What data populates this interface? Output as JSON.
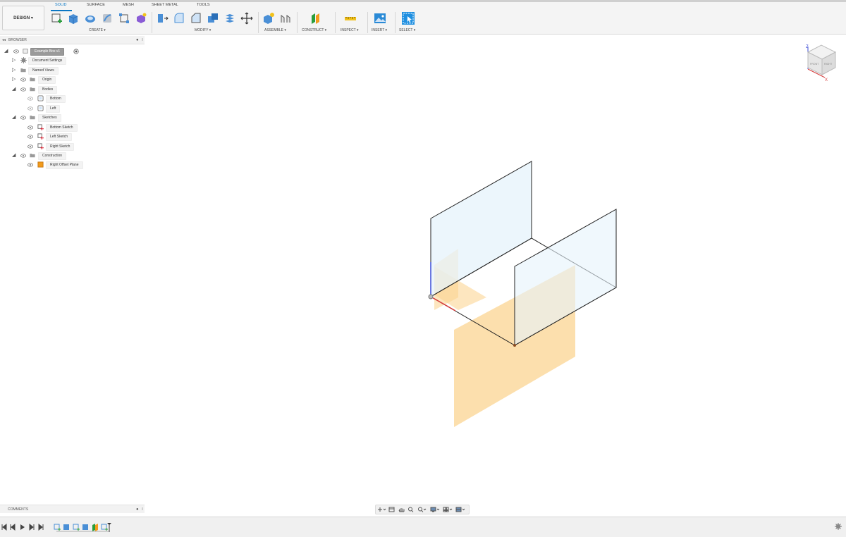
{
  "workspace": {
    "label": "DESIGN ▾"
  },
  "tabs": [
    {
      "label": "SOLID",
      "active": true
    },
    {
      "label": "SURFACE",
      "active": false
    },
    {
      "label": "MESH",
      "active": false
    },
    {
      "label": "SHEET METAL",
      "active": false
    },
    {
      "label": "TOOLS",
      "active": false
    }
  ],
  "groups": {
    "create": "CREATE ▾",
    "modify": "MODIFY ▾",
    "assemble": "ASSEMBLE ▾",
    "construct": "CONSTRUCT ▾",
    "inspect": "INSPECT ▾",
    "insert": "INSERT ▾",
    "select": "SELECT ▾"
  },
  "browser": {
    "title": "BROWSER",
    "items": [
      {
        "label": "Example Box v1",
        "icon": "document-icon",
        "selected": true
      },
      {
        "label": "Document Settings",
        "icon": "gear-icon"
      },
      {
        "label": "Named Views",
        "icon": "folder-icon"
      },
      {
        "label": "Origin",
        "icon": "folder-icon"
      },
      {
        "label": "Bodies",
        "icon": "folder-icon"
      },
      {
        "label": "Bottom",
        "icon": "body-icon"
      },
      {
        "label": "Left",
        "icon": "body-icon"
      },
      {
        "label": "Sketches",
        "icon": "folder-icon"
      },
      {
        "label": "Bottom Sketch",
        "icon": "sketch-icon"
      },
      {
        "label": "Left Sketch",
        "icon": "sketch-icon"
      },
      {
        "label": "Right Sketch",
        "icon": "sketch-icon"
      },
      {
        "label": "Construction",
        "icon": "folder-icon"
      },
      {
        "label": "Right Offset Plane",
        "icon": "plane-icon"
      }
    ]
  },
  "comments": {
    "title": "COMMENTS"
  },
  "viewcube": {
    "axis_z": "Z",
    "axis_x": "X",
    "face_front": "FRONT",
    "face_right": "RIGHT"
  },
  "colors": {
    "accent": "#0b77c4",
    "plane": "#fbd28a",
    "body": "#e6f3fb"
  }
}
